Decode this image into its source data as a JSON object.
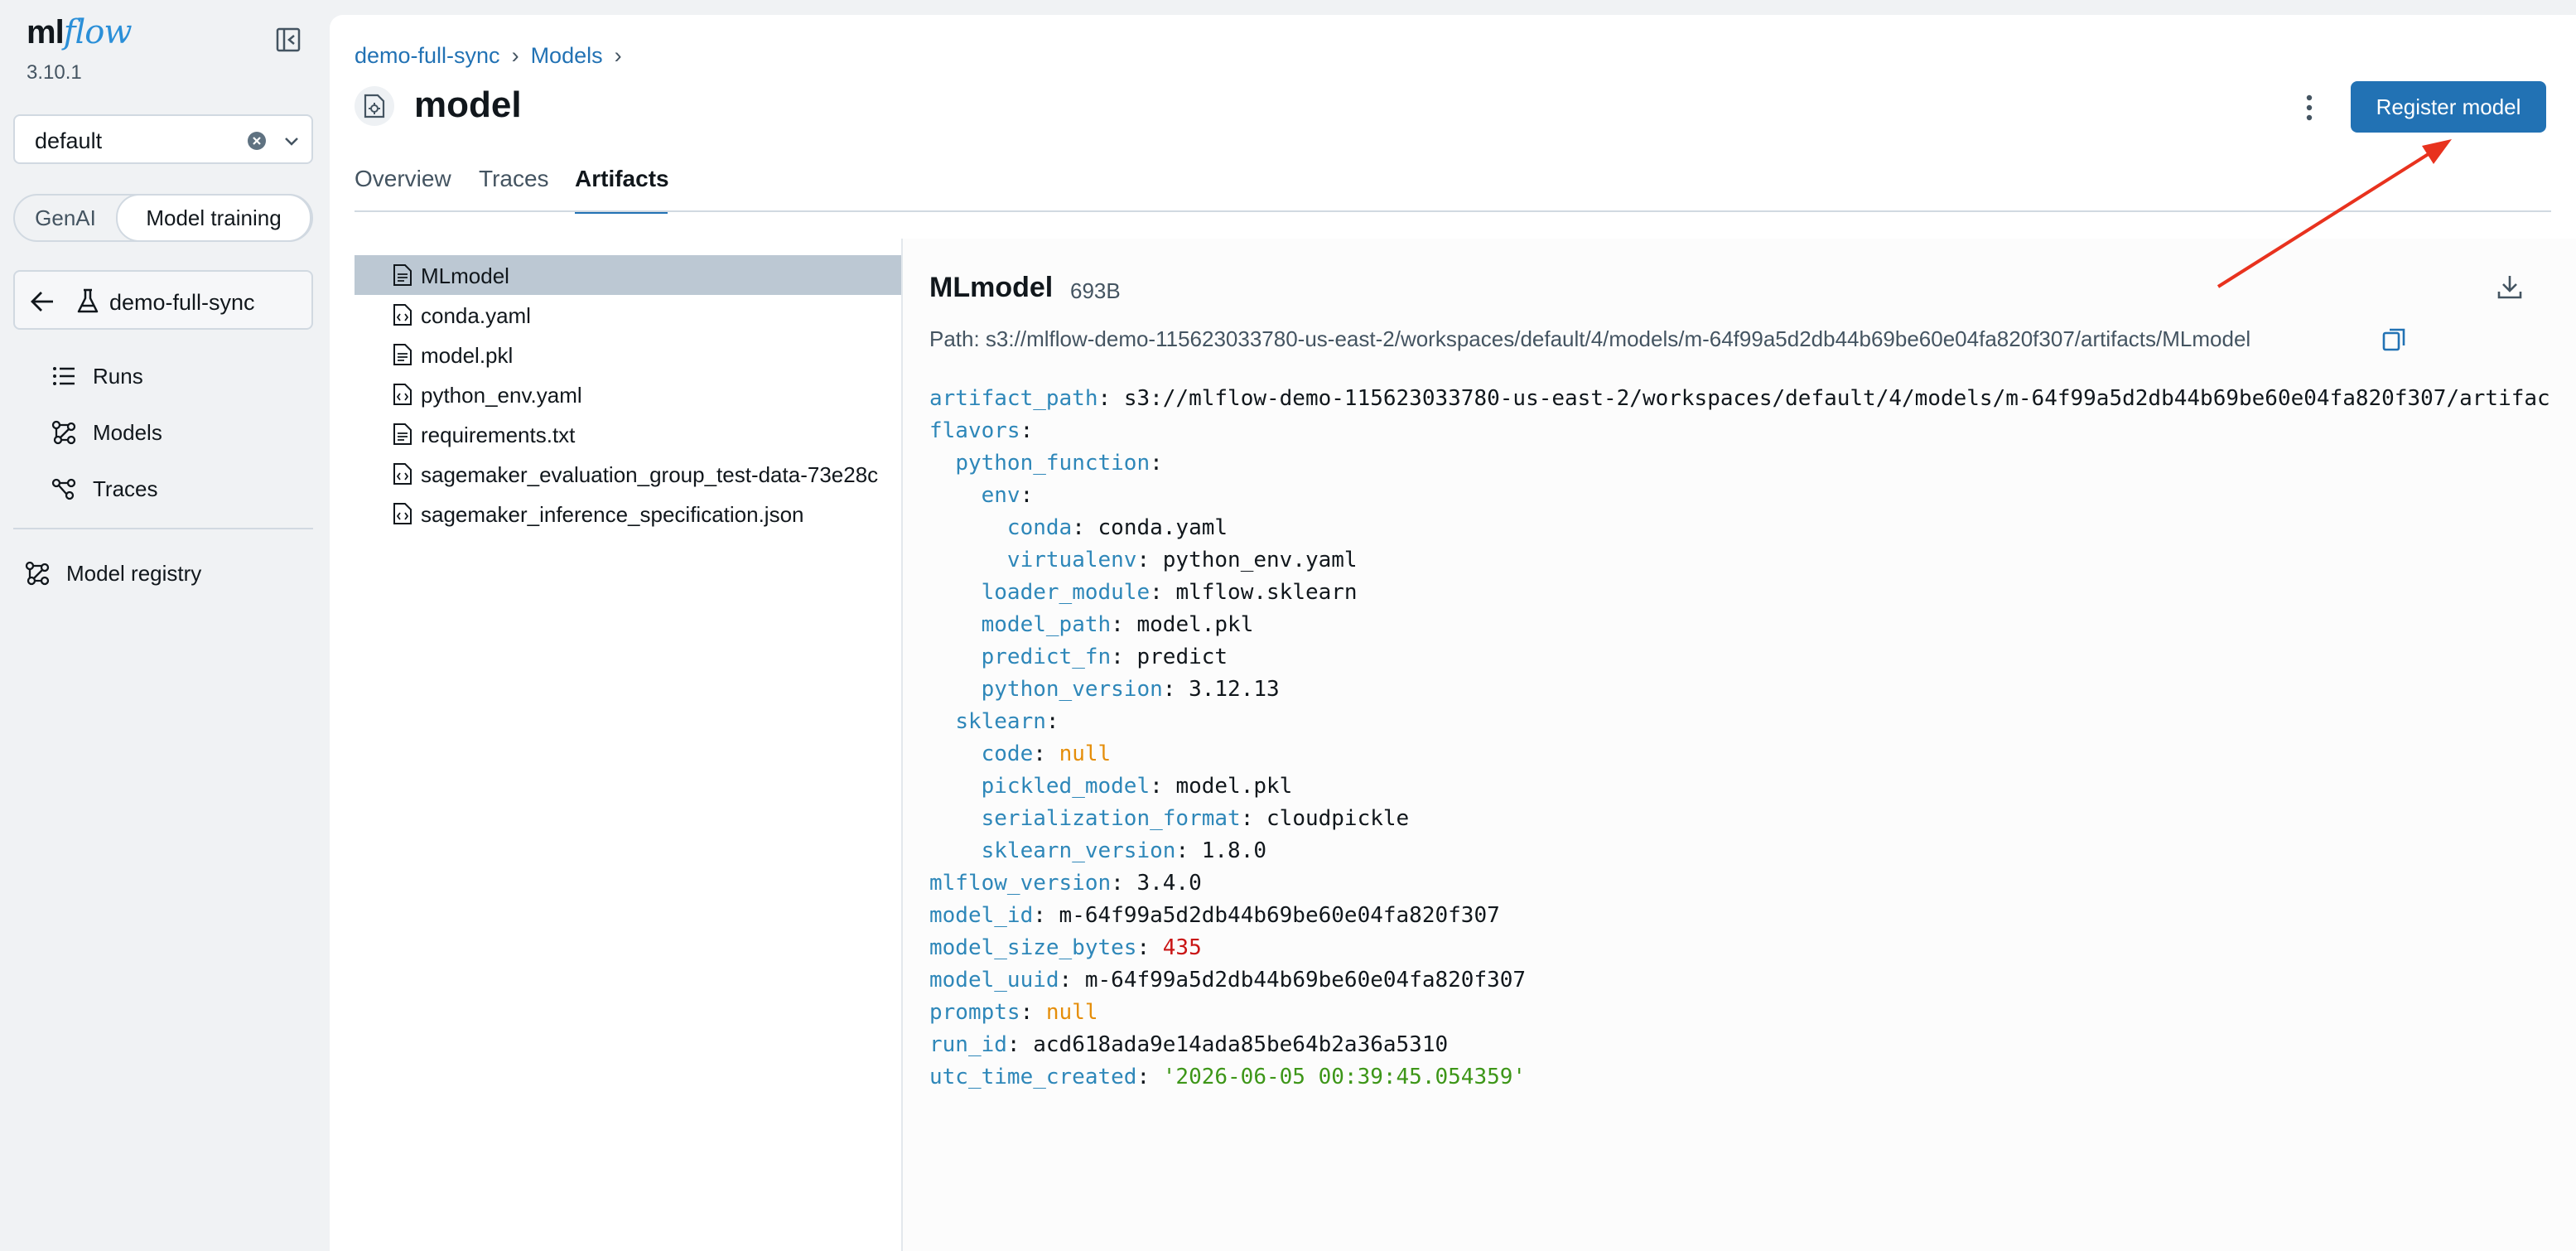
{
  "app": {
    "logo_ml": "ml",
    "logo_flow": "flow",
    "version": "3.10.1"
  },
  "sidebar": {
    "workspace": "default",
    "toggle": [
      "GenAI",
      "Model training"
    ],
    "experiment": "demo-full-sync",
    "nav": [
      {
        "label": "Runs",
        "icon": "list-icon"
      },
      {
        "label": "Models",
        "icon": "models-icon"
      },
      {
        "label": "Traces",
        "icon": "traces-icon"
      }
    ],
    "registry": "Model registry"
  },
  "header": {
    "breadcrumb": [
      "demo-full-sync",
      "Models"
    ],
    "title": "model",
    "register_label": "Register model"
  },
  "tabs": [
    "Overview",
    "Traces",
    "Artifacts"
  ],
  "active_tab": "Artifacts",
  "files": [
    "MLmodel",
    "conda.yaml",
    "model.pkl",
    "python_env.yaml",
    "requirements.txt",
    "sagemaker_evaluation_group_test-data-73e28c",
    "sagemaker_inference_specification.json"
  ],
  "viewer": {
    "name": "MLmodel",
    "size": "693B",
    "path": "Path: s3://mlflow-demo-115623033780-us-east-2/workspaces/default/4/models/m-64f99a5d2db44b69be60e04fa820f307/artifacts/MLmodel"
  },
  "code": [
    {
      "indent": "",
      "key": "artifact_path",
      "value": "s3://mlflow-demo-115623033780-us-east-2/workspaces/default/4/models/m-64f99a5d2db44b69be60e04fa820f307/artifac",
      "type": "plain"
    },
    {
      "indent": "",
      "key": "flavors",
      "value": "",
      "type": "plain"
    },
    {
      "indent": "  ",
      "key": "python_function",
      "value": "",
      "type": "plain"
    },
    {
      "indent": "    ",
      "key": "env",
      "value": "",
      "type": "plain"
    },
    {
      "indent": "      ",
      "key": "conda",
      "value": "conda.yaml",
      "type": "plain"
    },
    {
      "indent": "      ",
      "key": "virtualenv",
      "value": "python_env.yaml",
      "type": "plain"
    },
    {
      "indent": "    ",
      "key": "loader_module",
      "value": "mlflow.sklearn",
      "type": "plain"
    },
    {
      "indent": "    ",
      "key": "model_path",
      "value": "model.pkl",
      "type": "plain"
    },
    {
      "indent": "    ",
      "key": "predict_fn",
      "value": "predict",
      "type": "plain"
    },
    {
      "indent": "    ",
      "key": "python_version",
      "value": "3.12.13",
      "type": "plain"
    },
    {
      "indent": "  ",
      "key": "sklearn",
      "value": "",
      "type": "plain"
    },
    {
      "indent": "    ",
      "key": "code",
      "value": "null",
      "type": "null"
    },
    {
      "indent": "    ",
      "key": "pickled_model",
      "value": "model.pkl",
      "type": "plain"
    },
    {
      "indent": "    ",
      "key": "serialization_format",
      "value": "cloudpickle",
      "type": "plain"
    },
    {
      "indent": "    ",
      "key": "sklearn_version",
      "value": "1.8.0",
      "type": "plain"
    },
    {
      "indent": "",
      "key": "mlflow_version",
      "value": "3.4.0",
      "type": "plain"
    },
    {
      "indent": "",
      "key": "model_id",
      "value": "m-64f99a5d2db44b69be60e04fa820f307",
      "type": "plain"
    },
    {
      "indent": "",
      "key": "model_size_bytes",
      "value": "435",
      "type": "number"
    },
    {
      "indent": "",
      "key": "model_uuid",
      "value": "m-64f99a5d2db44b69be60e04fa820f307",
      "type": "plain"
    },
    {
      "indent": "",
      "key": "prompts",
      "value": "null",
      "type": "null"
    },
    {
      "indent": "",
      "key": "run_id",
      "value": "acd618ada9e14ada85be64b2a36a5310",
      "type": "plain"
    },
    {
      "indent": "",
      "key": "utc_time_created",
      "value": "'2026-06-05 00:39:45.054359'",
      "type": "string"
    }
  ],
  "colors": {
    "accent": "#2272b4",
    "annotation": "#e8321e"
  }
}
